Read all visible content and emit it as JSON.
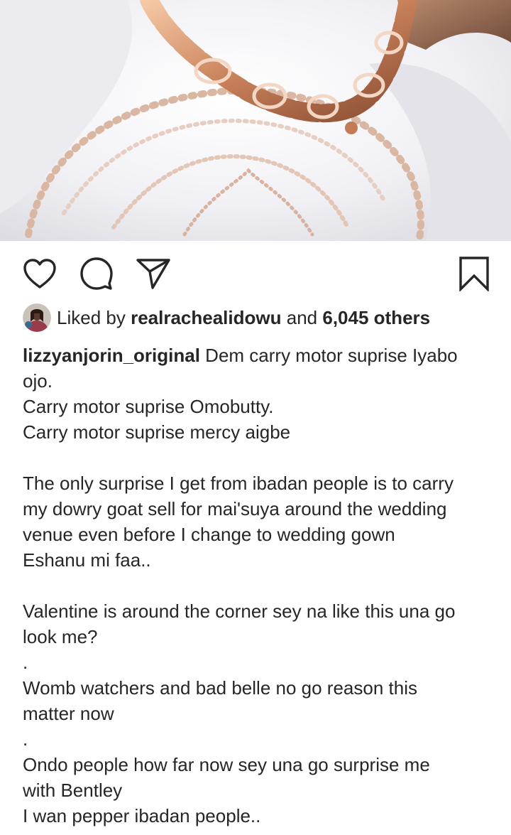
{
  "post": {
    "photo": {
      "semantic": "post-photo"
    },
    "actions": {
      "like_icon": "heart-outline-icon",
      "comment_icon": "comment-bubble-icon",
      "share_icon": "paper-plane-icon",
      "save_icon": "bookmark-outline-icon"
    },
    "likes": {
      "prefix": "Liked by",
      "user": "realrachealidowu",
      "connector": "and",
      "others": "6,045 others"
    },
    "caption": {
      "username": "lizzyanjorin_original",
      "first_line_text": "Dem carry motor suprise Iyabo",
      "lines": [
        "ojo.",
        "Carry motor suprise Omobutty.",
        "Carry motor suprise mercy aigbe",
        "",
        "The only surprise I get from ibadan people is to carry",
        "my dowry goat sell for mai'suya around the wedding",
        "venue even before I change to wedding gown",
        "Eshanu mi faa..",
        "",
        "Valentine is around the corner sey na like this una go",
        "look me?",
        ".",
        "Womb watchers and bad belle no go reason this",
        "matter now",
        ".",
        "Ondo people how far now sey una go surprise me",
        "with Bentley",
        "I wan pepper ibadan people.."
      ]
    }
  },
  "colors": {
    "text": "#262626",
    "icon": "#262626",
    "background": "#ffffff"
  }
}
